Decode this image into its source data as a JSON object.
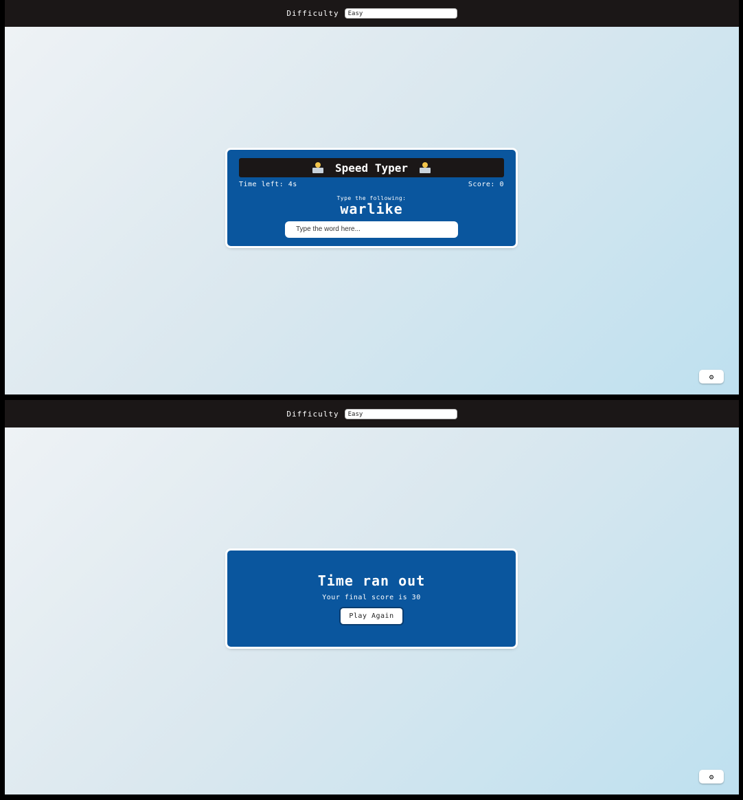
{
  "top": {
    "difficulty_label": "Difficulty",
    "difficulty_value": "Easy",
    "title": "Speed Typer",
    "time_left": "Time left: 4s",
    "score": "Score: 0",
    "prompt_label": "Type the following:",
    "word": "warlike",
    "input_placeholder": "Type the word here...",
    "icon_left": "technologist-emoji-icon",
    "icon_right": "technologist-emoji-icon",
    "settings_icon": "gear-icon"
  },
  "bottom": {
    "difficulty_label": "Difficulty",
    "difficulty_value": "Easy",
    "end_title": "Time ran out",
    "final_score": "Your final score is 30",
    "play_again_label": "Play Again",
    "settings_icon": "gear-icon"
  },
  "colors": {
    "topbar": "#1b1717",
    "card": "#0a569e",
    "bg_start": "#eef2f5",
    "bg_end": "#bee0ef"
  }
}
